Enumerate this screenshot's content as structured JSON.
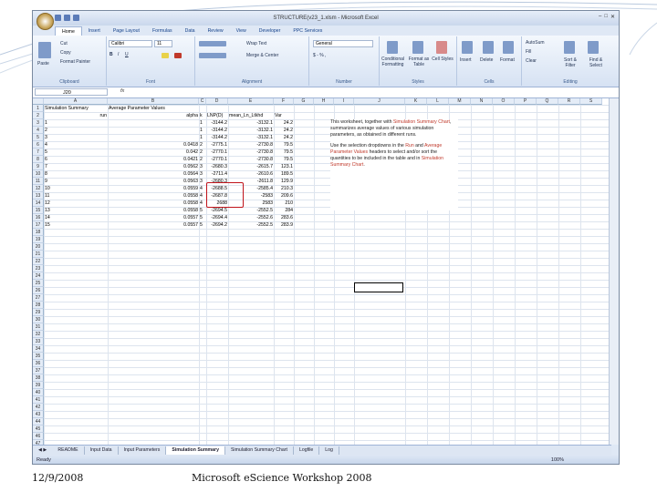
{
  "window": {
    "title": "STRUCTURE(v23_1.xlsm - Microsoft Excel"
  },
  "ribbon_tabs": [
    "Home",
    "Insert",
    "Page Layout",
    "Formulas",
    "Data",
    "Review",
    "View",
    "Developer",
    "PPC Services"
  ],
  "ribbon": {
    "clipboard": {
      "paste": "Paste",
      "cut": "Cut",
      "copy": "Copy",
      "format_painter": "Format Painter",
      "label": "Clipboard"
    },
    "font": {
      "name": "Calibri",
      "size": "11",
      "label": "Font"
    },
    "alignment": {
      "wrap": "Wrap Text",
      "merge": "Merge & Center",
      "label": "Alignment"
    },
    "number": {
      "format": "General",
      "label": "Number"
    },
    "styles": {
      "conditional": "Conditional Formatting",
      "format_table": "Format as Table",
      "cell_styles": "Cell Styles",
      "label": "Styles"
    },
    "cells": {
      "insert": "Insert",
      "delete": "Delete",
      "format": "Format",
      "label": "Cells"
    },
    "editing": {
      "autosum": "AutoSum",
      "fill": "Fill",
      "clear": "Clear",
      "sort": "Sort & Filter",
      "find": "Find & Select",
      "label": "Editing"
    }
  },
  "formula_bar": {
    "name_box": "J20",
    "fx": "fx"
  },
  "columns": [
    "A",
    "B",
    "C",
    "D",
    "E",
    "F",
    "G",
    "H",
    "I",
    "J",
    "K",
    "L",
    "M",
    "N",
    "O",
    "P",
    "Q",
    "R",
    "S"
  ],
  "headers": {
    "row1": [
      "Simulation Summary",
      "Average Parameter Values"
    ],
    "row2": [
      "run",
      "alpha",
      "k",
      "LNP(D)",
      "mean_Ln_Ltkhd",
      "Var"
    ]
  },
  "rows": [
    [
      "1",
      "",
      "1",
      "-3144.2",
      "-3132.1",
      "24.2"
    ],
    [
      "2",
      "",
      "1",
      "-3144.2",
      "-3132.1",
      "24.2"
    ],
    [
      "3",
      "",
      "1",
      "-3144.2",
      "-3132.1",
      "24.2"
    ],
    [
      "4",
      "0.0418",
      "2",
      "-2775.1",
      "-2730.8",
      "79.5"
    ],
    [
      "5",
      "0.042",
      "2",
      "-2770.1",
      "-2730.8",
      "79.5"
    ],
    [
      "6",
      "0.0421",
      "2",
      "-2770.1",
      "-2730.8",
      "79.5"
    ],
    [
      "7",
      "0.0562",
      "3",
      "-2680.3",
      "-2615.7",
      "123.1"
    ],
    [
      "8",
      "0.0564",
      "3",
      "-2711.4",
      "-2610.6",
      "189.5"
    ],
    [
      "9",
      "0.0563",
      "3",
      "-2680.3",
      "-2611.8",
      "129.9"
    ],
    [
      "10",
      "0.0559",
      "4",
      "-2688.5",
      "-2585.4",
      "210.3"
    ],
    [
      "11",
      "0.0558",
      "4",
      "-2687.8",
      "-2583",
      "209.6"
    ],
    [
      "12",
      "0.0558",
      "4",
      "2688",
      "2583",
      "210"
    ],
    [
      "13",
      "0.0558",
      "5",
      "-2694.5",
      "-2552.5",
      "284"
    ],
    [
      "14",
      "0.0557",
      "5",
      "-2694.4",
      "-2552.6",
      "283.6"
    ],
    [
      "15",
      "0.0557",
      "5",
      "-2694.2",
      "-2552.5",
      "283.9"
    ]
  ],
  "row_numbers": [
    "1",
    "2",
    "3",
    "4",
    "5",
    "6",
    "7",
    "8",
    "9",
    "10",
    "11",
    "12",
    "13",
    "14",
    "15",
    "16",
    "17",
    "18",
    "19",
    "20",
    "21",
    "22",
    "23",
    "24",
    "25",
    "26",
    "27",
    "28",
    "29",
    "30",
    "31",
    "32",
    "33",
    "34",
    "35",
    "36",
    "37",
    "38",
    "39",
    "40",
    "41",
    "42",
    "43",
    "44",
    "45",
    "46",
    "47",
    "48"
  ],
  "note": {
    "p1_a": "This worksheet, together with ",
    "p1_b": "Simulation Summary Chart",
    "p1_c": ", summarizes average values of various simulation parameters, as obtained in different runs.",
    "p2_a": "Use the selection dropdowns in the ",
    "p2_b": "Run",
    "p2_c": " and ",
    "p2_d": "Average Parameter Values",
    "p2_e": " headers to select and/or sort the quantities to be included in the table and in ",
    "p2_f": "Simulation Summary Chart",
    "p2_g": "."
  },
  "sheet_tabs": [
    "README",
    "Input Data",
    "Input Parameters",
    "Simulation Summary",
    "Simulation Summary Chart",
    "Logfile",
    "Log"
  ],
  "active_sheet": "Simulation Summary",
  "status": {
    "ready": "Ready",
    "zoom": "100%"
  },
  "footer": {
    "date": "12/9/2008",
    "event": "Microsoft eScience Workshop 2008"
  }
}
